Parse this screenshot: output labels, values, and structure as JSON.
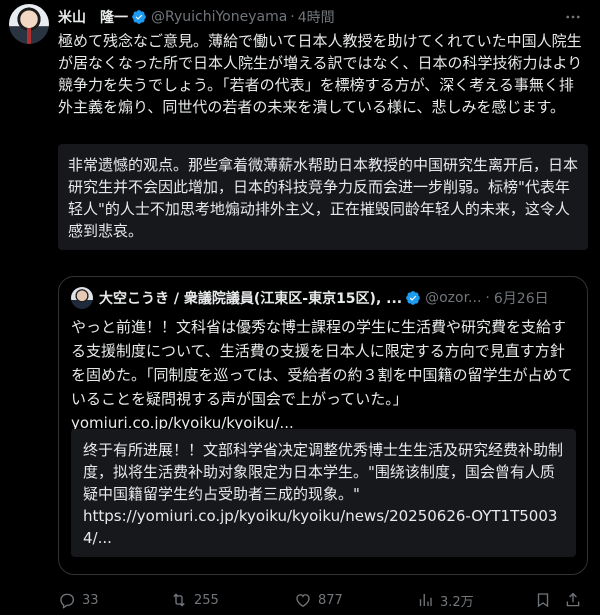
{
  "post": {
    "author": {
      "display_name": "米山　隆一",
      "handle": "@RyuichiYoneyama",
      "time": "4時間",
      "verified_icon": "verified-badge-icon"
    },
    "text": "極めて残念なご意見。薄給で働いて日本人教授を助けてくれていた中国人院生が居なくなった所で日本人院生が増える訳ではなく、日本の科学技術力はより競争力を失うでしょう。「若者の代表」を標榜する方が、深く考える事無く排外主義を煽り、同世代の若者の未来を潰している様に、悲しみを感じます。",
    "translation": "非常遗憾的观点。那些拿着微薄薪水帮助日本教授的中国研究生离开后，日本研究生并不会因此增加，日本的科技竞争力反而会进一步削弱。标榜\"代表年轻人\"的人士不加思考地煽动排外主义，正在摧毁同龄年轻人的未来，这令人感到悲哀。"
  },
  "quote": {
    "author": {
      "display_name": "大空こうき / 衆議院議員(江東区-東京15区), ...",
      "handle": "@ozor...",
      "time": "6月26日"
    },
    "text": "やっと前進！！文科省は優秀な博士課程の学生に生活費や研究費を支給する支援制度について、生活費の支援を日本人に限定する方向で見直す方針を固めた。「同制度を巡っては、受給者の約３割を中国籍の留学生が占めていることを疑問視する声が国会で上がっていた。」",
    "link": "yomiuri.co.jp/kyoiku/kyoiku/...",
    "translation": "终于有所进展！！文部科学省决定调整优秀博士生生活及研究经费补助制度，拟将生活费补助对象限定为日本学生。\"围绕该制度，国会曾有人质疑中国籍留学生约占受助者三成的现象。\"",
    "translation_link": "https://yomiuri.co.jp/kyoiku/kyoiku/news/20250626-OYT1T50034/..."
  },
  "actions": {
    "reply_count": "33",
    "repost_count": "255",
    "like_count": "877",
    "views_count": "3.2万"
  },
  "colors": {
    "background": "#000000",
    "text": "#e7e9ea",
    "muted": "#71767b",
    "verified": "#1d9bf0",
    "card": "#16181c",
    "border": "#2f3336"
  }
}
